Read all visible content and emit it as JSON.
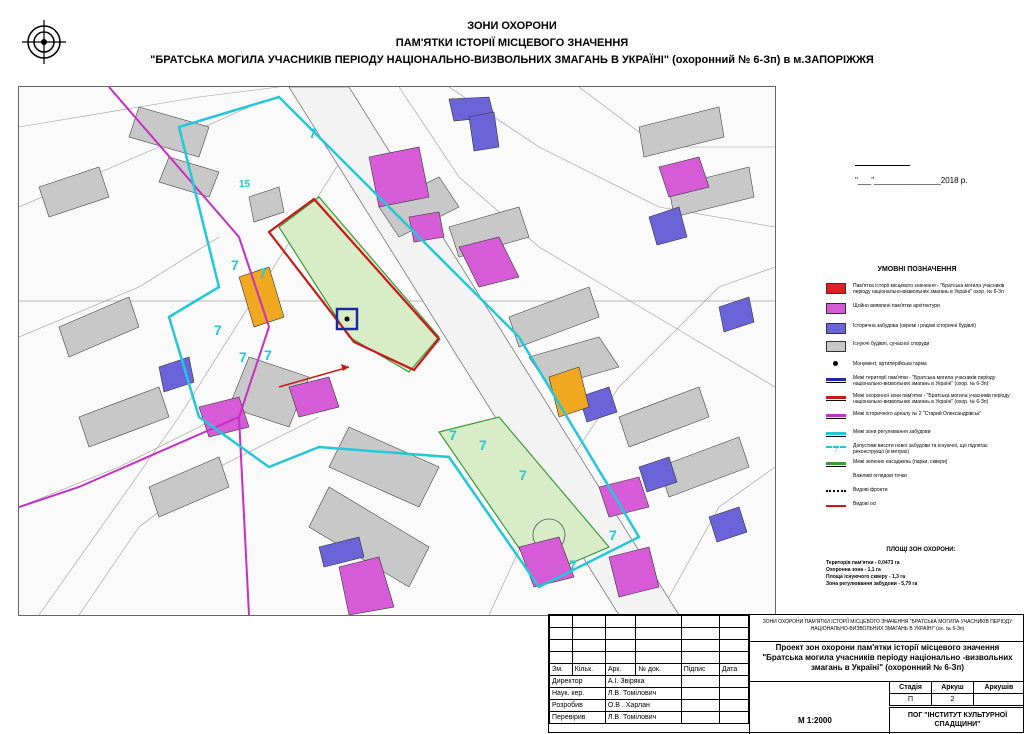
{
  "header": {
    "line1": "ЗОНИ ОХОРОНИ",
    "line2": "ПАМ'ЯТКИ ІСТОРІЇ МІСЦЕВОГО ЗНАЧЕННЯ",
    "line3": "\"БРАТСЬКА МОГИЛА УЧАСНИКІВ ПЕРІОДУ НАЦІОНАЛЬНО-ВИЗВОЛЬНИХ ЗМАГАНЬ В УКРАЇНІ\" (охоронний № 6-Зп) в м.ЗАПОРІЖЖЯ"
  },
  "approval": {
    "date_line": "\"___\"_______________2018 р."
  },
  "legend": {
    "title": "УМОВНІ ПОЗНАЧЕННЯ",
    "items": [
      {
        "text": "Пам'ятка історії місцевого значення - \"Братська могила учасників періоду національно-визвольних змагань в Україні\" охор. № 6-Зп",
        "swatch": "#e02020",
        "style": "fill"
      },
      {
        "text": "Щойно виявлені пам'ятки архітектури",
        "swatch": "#d65bd6",
        "style": "fill"
      },
      {
        "text": "Історична забудова (окремі і рядові історичні будівлі)",
        "swatch": "#6a64d8",
        "style": "fill"
      },
      {
        "text": "Існуючі будівлі, сучасної споруди",
        "swatch": "#c8c8c8",
        "style": "fill"
      },
      {
        "text": "Монумент, артилерійська гарма",
        "swatch": "#000000",
        "style": "dot"
      },
      {
        "text": "Межі території пам'ятки - \"Братська могила учасників періоду національно-визвольних змагань в Україні\" (охор. № 6-Зп)",
        "swatch": "#1b2aa0",
        "style": "line"
      },
      {
        "text": "Межі охоронної зони пам'ятки - \"Братська могила учасників періоду національно-визвольних змагань в Україні\" (охор. № 6-Зп)",
        "swatch": "#c81818",
        "style": "line"
      },
      {
        "text": "Межі історичного ареалу № 2 \"Старий Олександрівськ\"",
        "swatch": "#c42fc4",
        "style": "line"
      },
      {
        "text": "Межі зони регулювання забудови",
        "swatch": "#22c8d8",
        "style": "line"
      },
      {
        "text": "Допустимі висоти нової забудови та існуючої, що підлягає реконструкції (в метрах)",
        "swatch": "#22c8d8",
        "style": "dash",
        "label": "7"
      },
      {
        "text": "Межі зелених насаджень (парки, сквери)",
        "swatch": "#3a9a3a",
        "style": "line"
      },
      {
        "text": "Важливі оглядові точки",
        "swatch": "#000000",
        "style": "none"
      },
      {
        "text": "Видові фронти",
        "swatch": "#000000",
        "style": "zigzag"
      },
      {
        "text": "Видові осі",
        "swatch": "#c81818",
        "style": "arrow"
      }
    ]
  },
  "areas": {
    "title": "ПЛОЩІ ЗОН ОХОРОНИ:",
    "lines": [
      "Територія пам'ятки - 0,0473 га",
      "Охоронна зона - 1,1 га",
      "Площа існуючого скверу - 1,3 га",
      "Зона регулювання забудови - 5,79 га"
    ]
  },
  "map": {
    "height_labels": [
      "15",
      "7",
      "7",
      "7",
      "7",
      "7",
      "7",
      "7",
      "7",
      "7",
      "7",
      "7"
    ],
    "colors": {
      "monument": "#e02020",
      "newly_found": "#d65bd6",
      "historic": "#6a64d8",
      "existing": "#c8c8c8",
      "orange": "#f0a820",
      "green": "#d9ecc8",
      "territory": "#1b2aa0",
      "protection": "#c81818",
      "areal": "#c42fc4",
      "regulation": "#22c8d8"
    }
  },
  "stamp": {
    "top_text": "ЗОНИ ОХОРОНИ ПАМ'ЯТКИ ІСТОРІЇ МІСЦЕВОГО ЗНАЧЕННЯ \"БРАТСЬКА МОГИЛА УЧАСНИКІВ ПЕРІОДУ НАЦІОНАЛЬНО-ВИЗВОЛЬНИХ ЗМАГАНЬ В УКРАЇНІ\" (ох. № 6-Зп)",
    "title_line1": "Проект зон охорони пам'ятки історії місцевого значення",
    "title_line2": "\"Братська могила учасників періоду національно -визвольних",
    "title_line3": "змагань в Україні\" (охоронний № 6-Зп)",
    "header_cells": [
      "Зм.",
      "Кільк.",
      "Арк.",
      "№ док.",
      "Підпис",
      "Дата"
    ],
    "rows": [
      {
        "role": "Директор",
        "name": "А.І. Звіряка"
      },
      {
        "role": "Наук. кер.",
        "name": "Л.В. Томілович"
      },
      {
        "role": "Розробив",
        "name": "О.В . Харлан"
      },
      {
        "role": "Перевірив",
        "name": "Л.В. Томілович"
      }
    ],
    "stage_headers": [
      "Стадія",
      "Аркуш",
      "Аркушів"
    ],
    "stage_values": [
      "П",
      "2",
      ""
    ],
    "scale": "М 1:2000",
    "org_line1": "ПОГ \"ІНСТИТУТ КУЛЬТУРНОЇ",
    "org_line2": "СПАДЩИНИ\""
  }
}
